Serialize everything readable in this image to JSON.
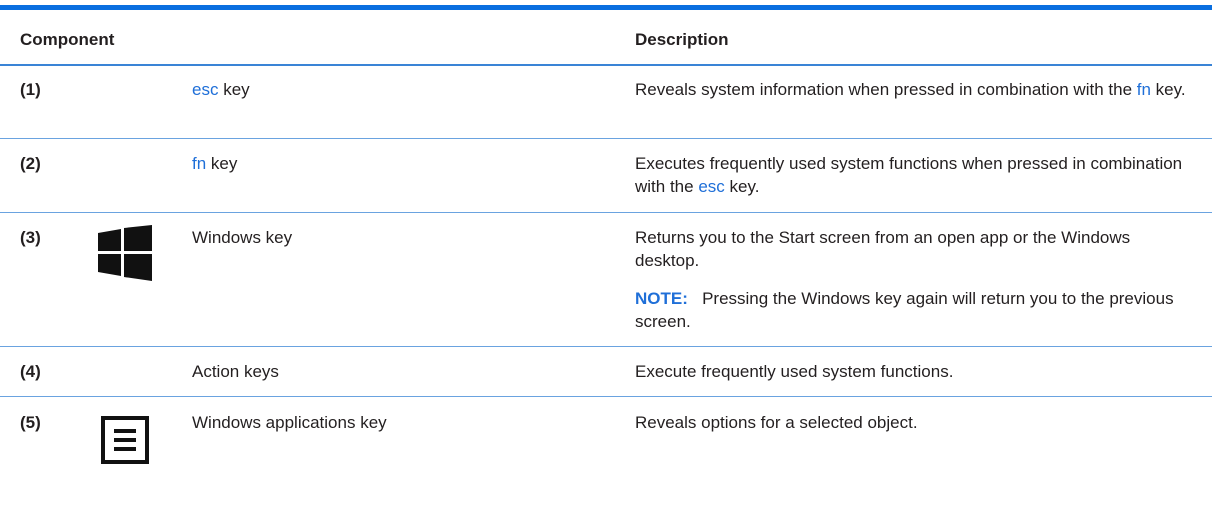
{
  "table": {
    "header": {
      "component": "Component",
      "description": "Description"
    },
    "rows": [
      {
        "num": "(1)",
        "keyword": "esc",
        "component_suffix": " key",
        "desc_a": "Reveals system information when pressed in combination with the ",
        "desc_kw": "fn",
        "desc_b": " key."
      },
      {
        "num": "(2)",
        "keyword": "fn",
        "component_suffix": " key",
        "desc_a": "Executes frequently used system functions when pressed in combination with the ",
        "desc_kw": "esc",
        "desc_b": " key."
      },
      {
        "num": "(3)",
        "icon": "windows-logo-icon",
        "component": "Windows key",
        "desc": "Returns you to the Start screen from an open app or the Windows desktop.",
        "note_label": "NOTE:",
        "note_text": "Pressing the Windows key again will return you to the previous screen."
      },
      {
        "num": "(4)",
        "component": "Action keys",
        "desc": "Execute frequently used system functions."
      },
      {
        "num": "(5)",
        "icon": "applications-key-icon",
        "component": "Windows applications key",
        "desc": "Reveals options for a selected object."
      }
    ]
  }
}
